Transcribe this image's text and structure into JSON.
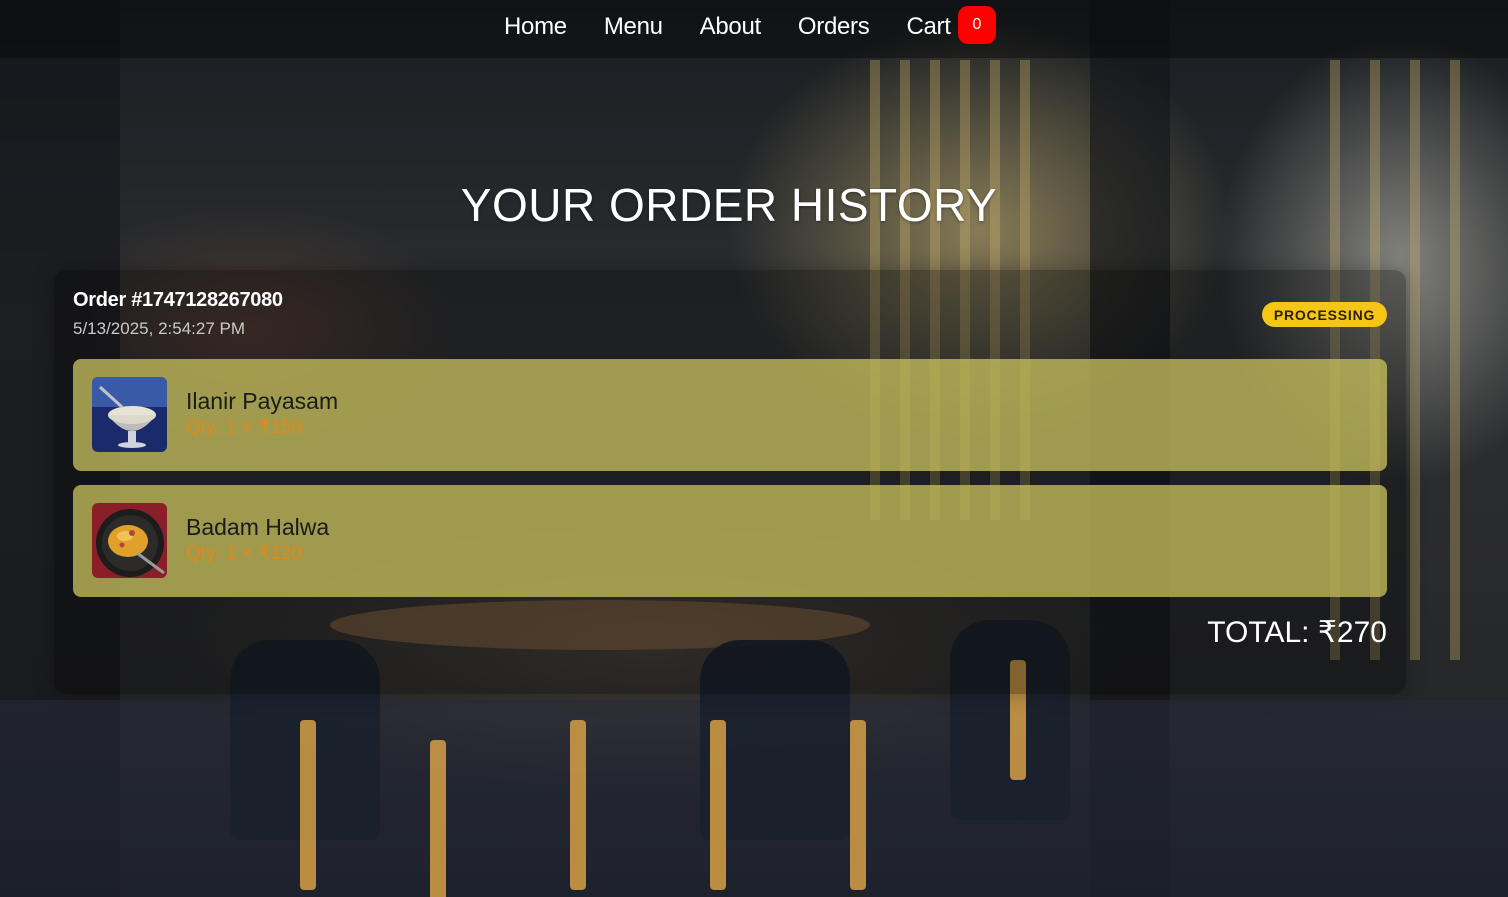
{
  "nav": {
    "links": [
      "Home",
      "Menu",
      "About",
      "Orders",
      "Cart"
    ],
    "cart_count": "0"
  },
  "page": {
    "title": "YOUR ORDER HISTORY"
  },
  "order": {
    "id": "Order #1747128267080",
    "date": "5/13/2025, 2:54:27 PM",
    "status": "PROCESSING",
    "items": [
      {
        "name": "Ilanir Payasam",
        "qty": "Qty: 1 × ₹150",
        "image_icon": "payasam-dessert-image"
      },
      {
        "name": "Badam Halwa",
        "qty": "Qty: 1 × ₹120",
        "image_icon": "halwa-dessert-image"
      }
    ],
    "total": "TOTAL: ₹270"
  },
  "colors": {
    "status_badge": "#f5c518",
    "cart_badge": "#ff0000",
    "item_background": "#c4be5c",
    "qty_text": "#e08a1a"
  }
}
